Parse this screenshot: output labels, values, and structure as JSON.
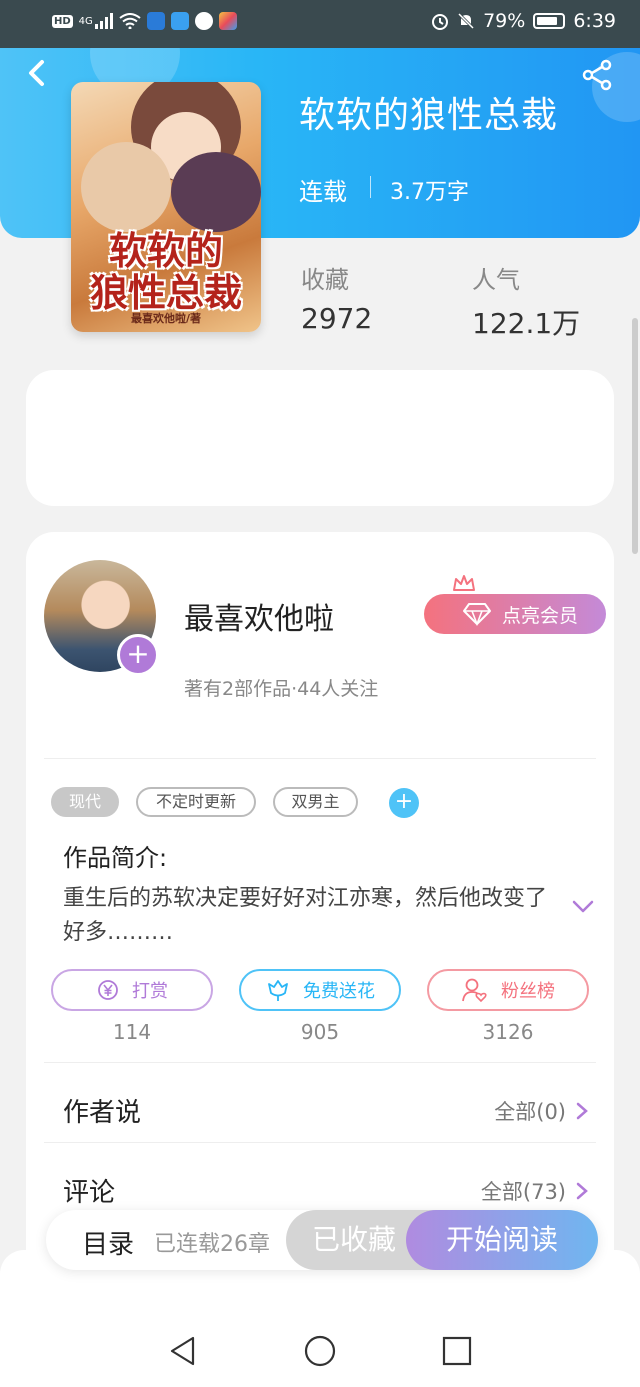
{
  "status_bar": {
    "network": "4G",
    "battery": "79%",
    "time": "6:39",
    "hd": "HD"
  },
  "book": {
    "title": "软软的狼性总裁",
    "status": "连载",
    "word_count": "3.7万字",
    "cover_title_line1": "软软的",
    "cover_title_line2": "狼性总裁",
    "cover_author": "最喜欢他啦/著"
  },
  "stats": {
    "favorites_label": "收藏",
    "favorites_value": "2972",
    "popularity_label": "人气",
    "popularity_value": "122.1万"
  },
  "author": {
    "name": "最喜欢他啦",
    "meta": "著有2部作品·44人关注",
    "vip_label": "点亮会员"
  },
  "tags": [
    "现代",
    "不定时更新",
    "双男主"
  ],
  "intro": {
    "label": "作品简介:",
    "text": "重生后的苏软决定要好好对江亦寒，然后他改变了好多………"
  },
  "actions": [
    {
      "label": "打赏",
      "count": "114",
      "color": "#b07ad8"
    },
    {
      "label": "免费送花",
      "count": "905",
      "color": "#29b6f6"
    },
    {
      "label": "粉丝榜",
      "count": "3126",
      "color": "#f4727e"
    }
  ],
  "sections": {
    "author_says_label": "作者说",
    "author_says_link": "全部(0)",
    "comments_label": "评论",
    "comments_link": "全部(73)"
  },
  "bottom_bar": {
    "toc_label": "目录",
    "toc_count": "已连载26章",
    "favorited_label": "已收藏",
    "read_label": "开始阅读"
  }
}
